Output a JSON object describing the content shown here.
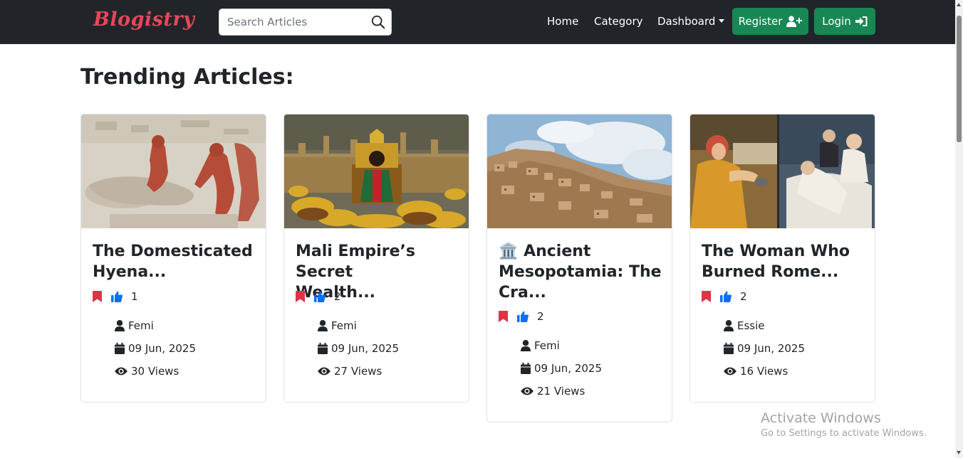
{
  "navbar": {
    "brand": "Blogistry",
    "search_placeholder": "Search Articles",
    "links": {
      "home": "Home",
      "category": "Category",
      "dashboard": "Dashboard"
    },
    "register_label": "Register",
    "login_label": "Login",
    "colors": {
      "background": "#212529",
      "brand": "#e8475a",
      "button": "#198754"
    }
  },
  "heading": "Trending Articles:",
  "cards": [
    {
      "title_line1": "The Domesticated",
      "title_line2": "Hyena...",
      "title_line3": "",
      "likes": "1",
      "author": "Femi",
      "date": "09 Jun, 2025",
      "views": "30 Views",
      "image": "egyptian-relief"
    },
    {
      "title_line1": "Mali Empire’s Secret",
      "title_line2": "Wealth...",
      "title_line3": "",
      "likes": "2",
      "author": "Femi",
      "date": "09 Jun, 2025",
      "views": "27 Views",
      "image": "mali-king-gold"
    },
    {
      "title_line1": "Ancient",
      "title_line2": "Mesopotamia: The",
      "title_line3": "Cra...",
      "title_emoji": "🏛️",
      "likes": "2",
      "author": "Femi",
      "date": "09 Jun, 2025",
      "views": "21 Views",
      "image": "hillside-city"
    },
    {
      "title_line1": "The Woman Who",
      "title_line2": "Burned Rome...",
      "title_line3": "",
      "likes": "2",
      "author": "Essie",
      "date": "09 Jun, 2025",
      "views": "16 Views",
      "image": "classical-paintings"
    }
  ],
  "icons": {
    "bookmark": "bookmark-icon",
    "like": "thumbs-up-icon",
    "user": "user-icon",
    "calendar": "calendar-icon",
    "views": "eye-icon",
    "search": "search-icon"
  },
  "accent_colors": {
    "bookmark": "#dc3545",
    "like": "#0d6efd"
  },
  "watermark": {
    "line1": "Activate Windows",
    "line2": "Go to Settings to activate Windows."
  }
}
